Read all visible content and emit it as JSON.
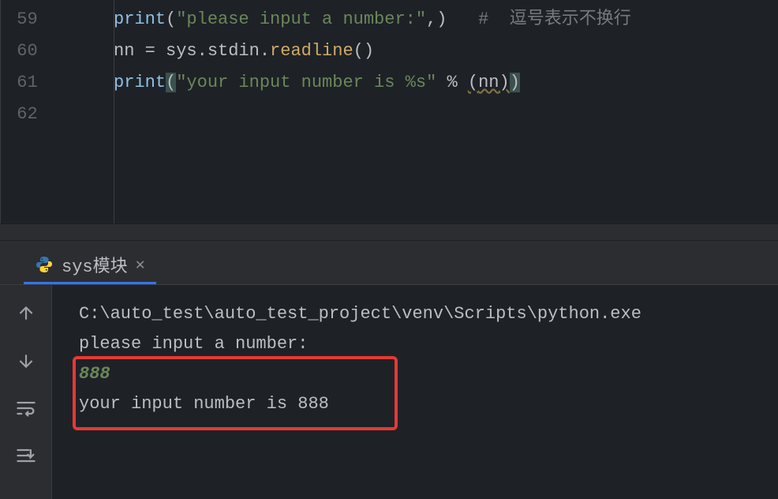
{
  "editor": {
    "lines": [
      {
        "num": "59"
      },
      {
        "num": "60"
      },
      {
        "num": "61"
      },
      {
        "num": "62"
      }
    ],
    "code": {
      "l59_print": "print",
      "l59_str": "\"please input a number:\"",
      "l59_comma": ",",
      "l59_comment": "#  逗号表示不换行",
      "l60_var": "nn",
      "l60_eq": " = ",
      "l60_sys": "sys",
      "l60_dot1": ".",
      "l60_stdin": "stdin",
      "l60_dot2": ".",
      "l60_readline": "readline",
      "l60_parens": "()",
      "l61_print": "print",
      "l61_lp": "(",
      "l61_str": "\"your input number is %s\"",
      "l61_mod": " % ",
      "l61_lp2": "(",
      "l61_nn": "nn",
      "l61_rp2": ")",
      "l61_rp": ")"
    }
  },
  "run": {
    "tab_label": "sys模块",
    "output": {
      "path": "C:\\auto_test\\auto_test_project\\venv\\Scripts\\python.exe ",
      "prompt": "please input a number:",
      "input": "888",
      "result": "your input number is 888"
    }
  }
}
